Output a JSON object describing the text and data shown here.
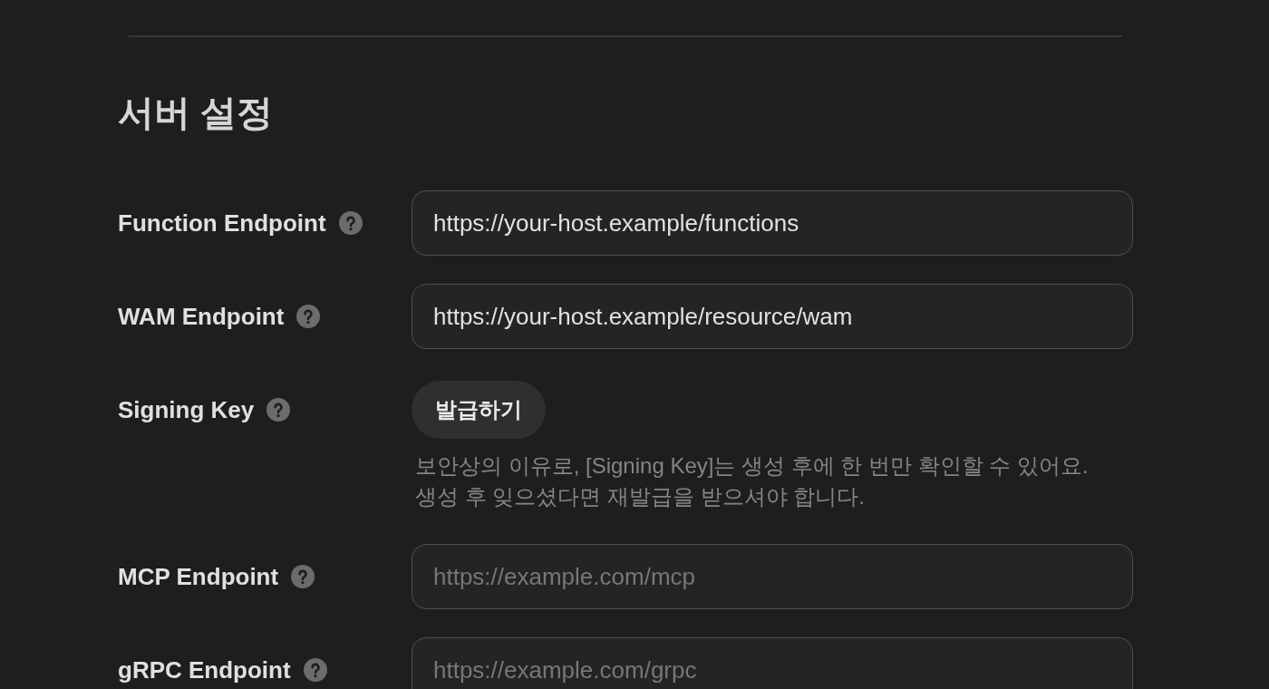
{
  "section": {
    "title": "서버 설정"
  },
  "fields": [
    {
      "kind": "input",
      "label": "Function Endpoint",
      "value": "https://your-host.example/functions"
    },
    {
      "kind": "input",
      "label": "WAM Endpoint",
      "value": "https://your-host.example/resource/wam"
    },
    {
      "kind": "button",
      "label": "Signing Key",
      "button": "발급하기",
      "hint": "보안상의 이유로, [Signing Key]는 생성 후에 한 번만 확인할 수 있어요. 생성 후 잊으셨다면 재발급을 받으셔야 합니다."
    },
    {
      "kind": "input",
      "label": "MCP Endpoint",
      "placeholder": "https://example.com/mcp"
    },
    {
      "kind": "input",
      "label": "gRPC Endpoint",
      "placeholder": "https://example.com/grpc"
    }
  ]
}
